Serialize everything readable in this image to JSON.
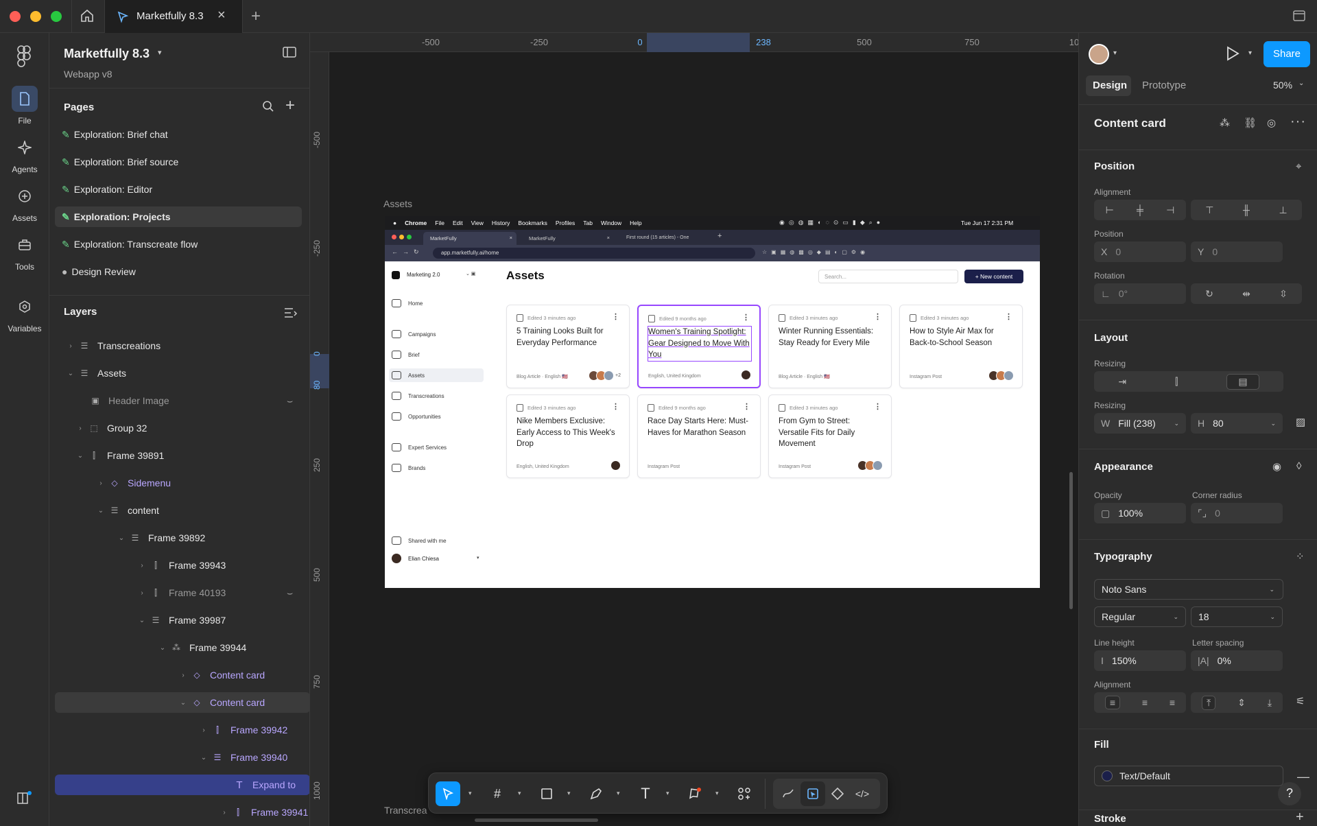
{
  "titlebar": {
    "tab_title": "Marketfully 8.3"
  },
  "rail": {
    "items": [
      {
        "label": "File"
      },
      {
        "label": "Agents"
      },
      {
        "label": "Assets"
      },
      {
        "label": "Tools"
      },
      {
        "label": "Variables"
      }
    ]
  },
  "left": {
    "file_name": "Marketfully 8.3",
    "file_sub": "Webapp v8",
    "pages_title": "Pages",
    "pages": [
      {
        "label": "Exploration: Brief chat"
      },
      {
        "label": "Exploration: Brief source"
      },
      {
        "label": "Exploration: Editor"
      },
      {
        "label": "Exploration: Projects"
      },
      {
        "label": "Exploration: Transcreate flow"
      },
      {
        "label": "Design Review"
      }
    ],
    "layers_title": "Layers",
    "layers": [
      {
        "label": "Transcreations"
      },
      {
        "label": "Assets"
      },
      {
        "label": "Header Image"
      },
      {
        "label": "Group 32"
      },
      {
        "label": "Frame 39891"
      },
      {
        "label": "Sidemenu"
      },
      {
        "label": "content"
      },
      {
        "label": "Frame 39892"
      },
      {
        "label": "Frame 39943"
      },
      {
        "label": "Frame 40193"
      },
      {
        "label": "Frame 39987"
      },
      {
        "label": "Frame 39944"
      },
      {
        "label": "Content card"
      },
      {
        "label": "Content card"
      },
      {
        "label": "Frame 39942"
      },
      {
        "label": "Frame 39940"
      },
      {
        "label": "Expand to"
      },
      {
        "label": "Frame 39941"
      }
    ]
  },
  "canvas": {
    "ruler_top": [
      "-500",
      "-250",
      "0",
      "238",
      "500",
      "750",
      "10"
    ],
    "ruler_left": [
      "-500",
      "-250",
      "0",
      "80",
      "250",
      "500",
      "750",
      "1000"
    ],
    "frame_label": "Assets",
    "frame_label_2": "Transcrea"
  },
  "screen": {
    "menubar": {
      "app": "Chrome",
      "items": [
        "File",
        "Edit",
        "View",
        "History",
        "Bookmarks",
        "Profiles",
        "Tab",
        "Window",
        "Help"
      ],
      "clock": "Tue Jun 17  2:31 PM"
    },
    "tabs": [
      "MarketFully",
      "MarketFully",
      "First round (15 articles) - One"
    ],
    "url": "app.marketfully.ai/home",
    "workspace": "Marketing 2.0",
    "nav": [
      "Home",
      "Campaigns",
      "Brief",
      "Assets",
      "Transcreations",
      "Opportunities",
      "Expert Services",
      "Brands"
    ],
    "shared": "Shared with me",
    "user": "Elian Chiesa",
    "heading": "Assets",
    "search_placeholder": "Search...",
    "new_button": "+ New content",
    "cards": [
      {
        "meta": "Edited 3 minutes ago",
        "title": "5 Training Looks Built for Everyday Performance",
        "footer": "Blog Article · English 🇺🇸",
        "extra": "+2"
      },
      {
        "meta": "Edited 9 months ago",
        "title": "Women's Training Spotlight: Gear Designed to Move With You",
        "footer": "English, United Kingdom"
      },
      {
        "meta": "Edited 3 minutes ago",
        "title": "Winter Running Essentials: Stay Ready for Every Mile",
        "footer": "Blog Article · English 🇺🇸"
      },
      {
        "meta": "Edited 3 minutes ago",
        "title": "How to Style Air Max for Back-to-School Season",
        "footer": "Instagram Post"
      },
      {
        "meta": "Edited 3 minutes ago",
        "title": "Nike Members Exclusive: Early Access to This Week's Drop",
        "footer": "English, United Kingdom"
      },
      {
        "meta": "Edited 9 months ago",
        "title": "Race Day Starts Here: Must-Haves for Marathon Season",
        "footer": "Instagram Post"
      },
      {
        "meta": "Edited 3 minutes ago",
        "title": "From Gym to Street: Versatile Fits for Daily Movement",
        "footer": "Instagram Post"
      }
    ]
  },
  "right": {
    "share": "Share",
    "tabs": [
      "Design",
      "Prototype"
    ],
    "zoom": "50%",
    "selection": "Content card",
    "position_title": "Position",
    "alignment_label": "Alignment",
    "position_label": "Position",
    "x_key": "X",
    "x_val": "0",
    "y_key": "Y",
    "y_val": "0",
    "rotation_label": "Rotation",
    "rotation_val": "0°",
    "layout_title": "Layout",
    "resizing_label": "Resizing",
    "resizing_label2": "Resizing",
    "w_key": "W",
    "w_val": "Fill (238)",
    "h_key": "H",
    "h_val": "80",
    "appearance_title": "Appearance",
    "opacity_label": "Opacity",
    "opacity_val": "100%",
    "radius_label": "Corner radius",
    "radius_val": "0",
    "typography_title": "Typography",
    "font": "Noto Sans",
    "weight": "Regular",
    "size": "18",
    "lh_label": "Line height",
    "lh_val": "150%",
    "ls_label": "Letter spacing",
    "ls_val": "0%",
    "align_label": "Alignment",
    "fill_title": "Fill",
    "fill_val": "Text/Default",
    "stroke_title": "Stroke",
    "help": "?"
  },
  "colors": {
    "accent": "#0d99ff",
    "selection": "#9747ff",
    "component": "#b9a7ff",
    "dark_nav": "#1b1f4a"
  }
}
